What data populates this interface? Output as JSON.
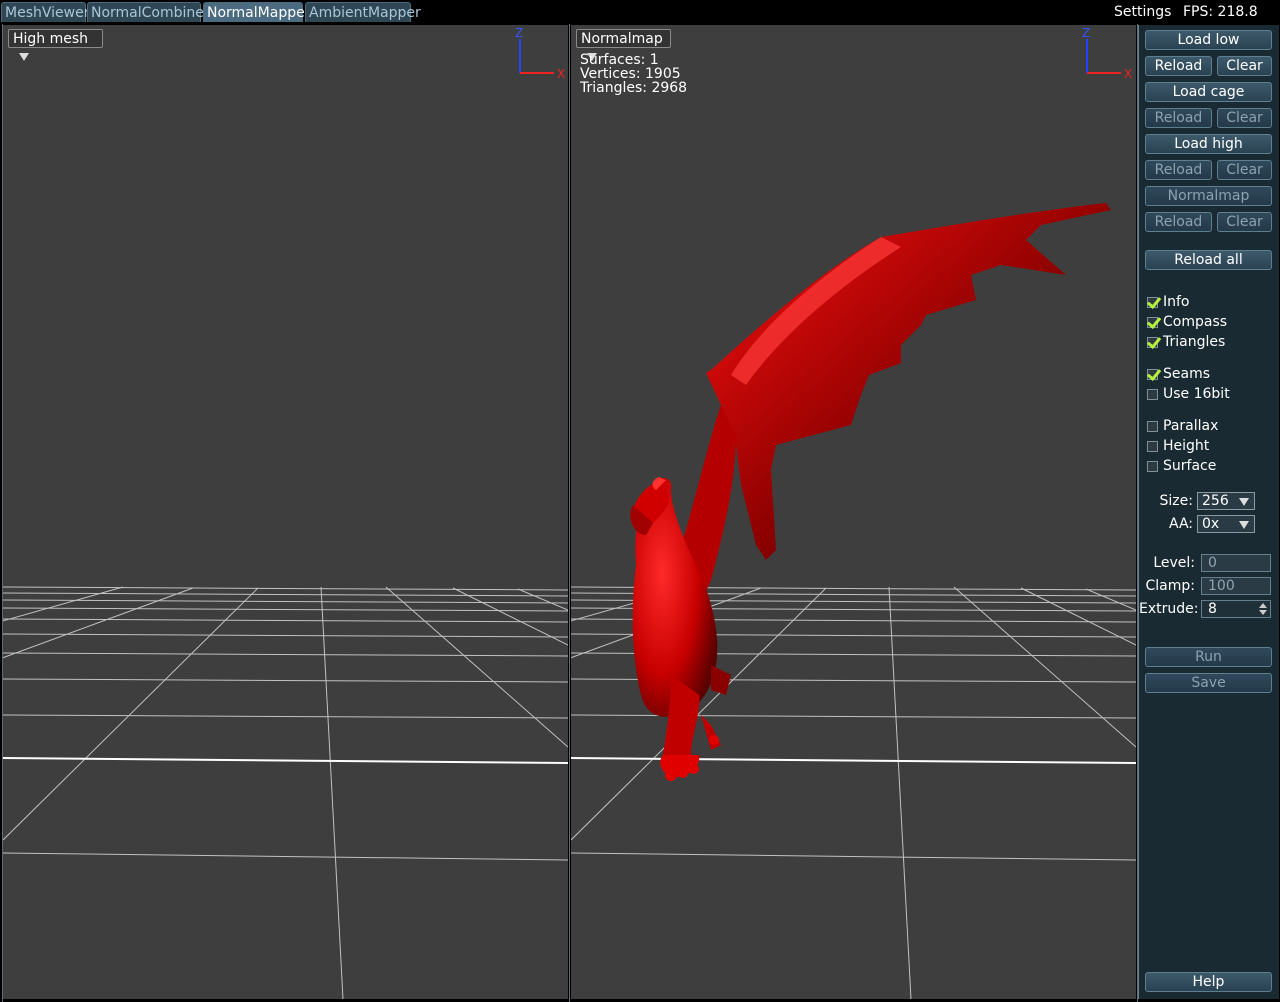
{
  "tabs": [
    {
      "label": "MeshViewer",
      "active": false
    },
    {
      "label": "NormalCombiner",
      "active": false
    },
    {
      "label": "NormalMapper",
      "active": true
    },
    {
      "label": "AmbientMapper",
      "active": false
    }
  ],
  "header": {
    "settings_label": "Settings",
    "fps": "FPS: 218.8"
  },
  "left_viewport": {
    "mode": "High mesh",
    "compass": {
      "z": "Z",
      "x": "X"
    }
  },
  "right_viewport": {
    "mode": "Normalmap",
    "info": {
      "surfaces": "Surfaces: 1",
      "vertices": "Vertices: 1905",
      "triangles": "Triangles: 2968"
    },
    "compass": {
      "z": "Z",
      "x": "X"
    },
    "model_color": "#d40000"
  },
  "panel": {
    "load_low": "Load low",
    "reload_low": "Reload",
    "clear_low": "Clear",
    "load_cage": "Load cage",
    "reload_cage": "Reload",
    "clear_cage": "Clear",
    "load_high": "Load high",
    "reload_high": "Reload",
    "clear_high": "Clear",
    "normalmap": "Normalmap",
    "reload_nm": "Reload",
    "clear_nm": "Clear",
    "reload_all": "Reload all",
    "checks": {
      "info": {
        "label": "Info",
        "checked": true
      },
      "compass": {
        "label": "Compass",
        "checked": true
      },
      "triangles": {
        "label": "Triangles",
        "checked": true
      },
      "seams": {
        "label": "Seams",
        "checked": true
      },
      "use16bit": {
        "label": "Use 16bit",
        "checked": false
      },
      "parallax": {
        "label": "Parallax",
        "checked": false
      },
      "height": {
        "label": "Height",
        "checked": false
      },
      "surface": {
        "label": "Surface",
        "checked": false
      }
    },
    "size_label": "Size:",
    "size_value": "256",
    "aa_label": "AA:",
    "aa_value": "0x",
    "level_label": "Level:",
    "level_value": "0",
    "clamp_label": "Clamp:",
    "clamp_value": "100",
    "extrude_label": "Extrude:",
    "extrude_value": "8",
    "run": "Run",
    "save": "Save",
    "help": "Help"
  },
  "colors": {
    "accent_check": "#b6f03c",
    "viewport_bg": "#3e3e3e",
    "panel_bg": "#1a2a32"
  }
}
